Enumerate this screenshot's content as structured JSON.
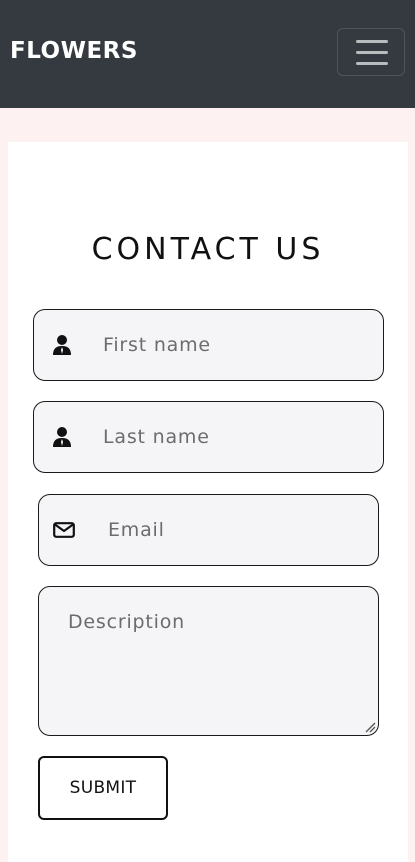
{
  "navbar": {
    "brand": "FLOWERS",
    "menu_icon": "hamburger-menu-icon"
  },
  "contact": {
    "heading": "CONTACT US",
    "first_name": {
      "placeholder": "First name",
      "icon": "user-icon"
    },
    "last_name": {
      "placeholder": "Last name",
      "icon": "user-icon"
    },
    "email": {
      "placeholder": "Email",
      "icon": "envelope-icon"
    },
    "description": {
      "placeholder": "Description"
    },
    "submit_label": "SUBMIT"
  },
  "colors": {
    "navbar_bg": "#343a40",
    "page_bg": "#fdf1f2",
    "field_bg": "#f5f5f7"
  }
}
